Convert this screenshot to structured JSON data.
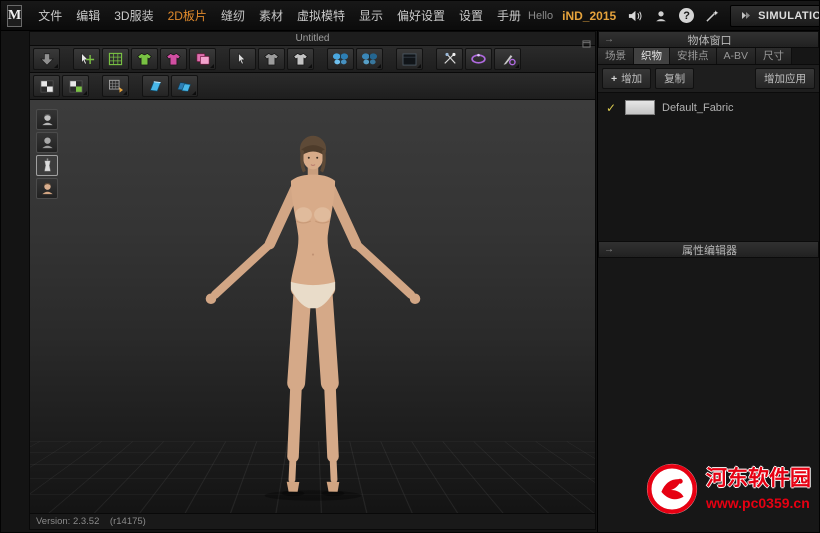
{
  "titlebar": {
    "logo": "M",
    "menus": [
      "文件",
      "编辑",
      "3D服装",
      "2D板片",
      "缝纫",
      "素材",
      "虚拟模特",
      "显示",
      "偏好设置",
      "设置",
      "手册"
    ],
    "active_menu": "2D板片",
    "hello_text": "Hello",
    "username": "iND_2015",
    "simulation_label": "SIMULATION",
    "caret": "▼",
    "help_glyph": "?",
    "window_buttons": {
      "minimize": "─",
      "maximize": "□",
      "close": "×"
    }
  },
  "viewport": {
    "tab_title": "Untitled",
    "version_text": "Version: 2.3.52    (r14175)"
  },
  "right_panel": {
    "object_window_title": "物体窗口",
    "section_arrow": "→",
    "tabs": [
      "场景",
      "织物",
      "安排点",
      "A-BV",
      "尺寸"
    ],
    "active_tab": "织物",
    "add_plus": "+",
    "add_label": "增加",
    "copy_label": "复制",
    "add_apply_label": "增加应用",
    "fabric_check": "✓",
    "fabric_name": "Default_Fabric",
    "property_editor_title": "属性编辑器"
  },
  "watermark": {
    "site_name": "河东软件园",
    "site_url": "www.pc0359.cn",
    "color": "#e60012"
  },
  "colors": {
    "accent_orange": "#e6a33c",
    "menu_active_orange": "#e08a2c",
    "watermark_red": "#e60012",
    "tool_blue": "#49b7e8",
    "tool_green": "#79c243",
    "tool_magenta": "#d14fa2",
    "tool_purple": "#b06ae0",
    "check_yellow": "#d9c94f"
  }
}
